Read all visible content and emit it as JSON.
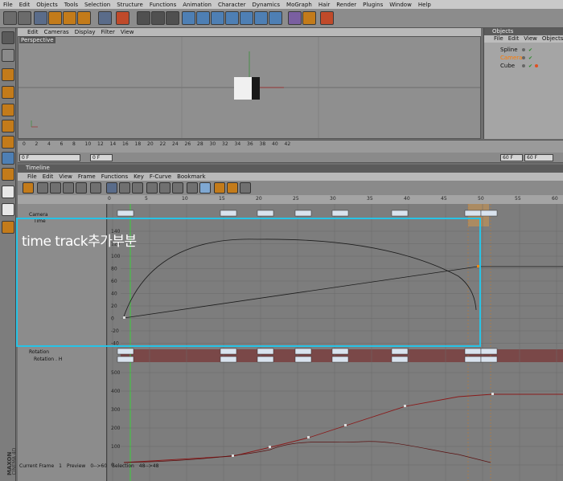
{
  "menubar": [
    "File",
    "Edit",
    "Objects",
    "Tools",
    "Selection",
    "Structure",
    "Functions",
    "Animation",
    "Character",
    "Dynamics",
    "MoGraph",
    "Hair",
    "Render",
    "Plugins",
    "Window",
    "Help"
  ],
  "viewport": {
    "menu": [
      "Edit",
      "Cameras",
      "Display",
      "Filter",
      "View"
    ],
    "label": "Perspective"
  },
  "objects": {
    "title": "Objects",
    "menu": [
      "File",
      "Edit",
      "View",
      "Objects"
    ],
    "items": [
      {
        "name": "Spline",
        "color": "#222222"
      },
      {
        "name": "Camera",
        "color": "#ff7a00"
      },
      {
        "name": "Cube",
        "color": "#222222"
      }
    ]
  },
  "frame_ruler": [
    "0",
    "2",
    "4",
    "6",
    "8",
    "10",
    "12",
    "14",
    "16",
    "18",
    "20",
    "22",
    "24",
    "26",
    "28",
    "30",
    "32",
    "34",
    "36",
    "38",
    "40",
    "42"
  ],
  "fields": {
    "start": "0 F",
    "end_a": "60 F",
    "end_b": "60 F",
    "current": "0 F"
  },
  "timeline": {
    "title": "Timeline",
    "menu": [
      "File",
      "Edit",
      "View",
      "Frame",
      "Functions",
      "Key",
      "F-Curve",
      "Bookmark"
    ],
    "ruler": [
      "0",
      "5",
      "10",
      "15",
      "20",
      "25",
      "30",
      "35",
      "40",
      "45",
      "50",
      "55",
      "60"
    ],
    "tracks": [
      {
        "label": "Camera"
      },
      {
        "label": "Time"
      },
      {
        "label": "Rotation"
      },
      {
        "label": "Rotation . H"
      }
    ],
    "upper_scale": [
      "140",
      "120",
      "100",
      "80",
      "60",
      "40",
      "20",
      "0",
      "-20",
      "-40"
    ],
    "lower_scale": [
      "500",
      "400",
      "300",
      "200",
      "100",
      "0"
    ]
  },
  "status": {
    "current_frame_label": "Current Frame",
    "current_frame": "1",
    "preview_label": "Preview",
    "preview": "0-->60",
    "selection_label": "Selection",
    "selection": "48-->48"
  },
  "brand": {
    "line1": "MAXON",
    "line2": "CINEMA 4D"
  },
  "annotation": {
    "text": "time track추가부분",
    "color": "#27c3e6"
  },
  "colors": {
    "accent": "#ff7a00",
    "graph_bg": "#7d7d7d",
    "rotation_track": "#7a4848",
    "keyframe": "#d9e3ee"
  }
}
